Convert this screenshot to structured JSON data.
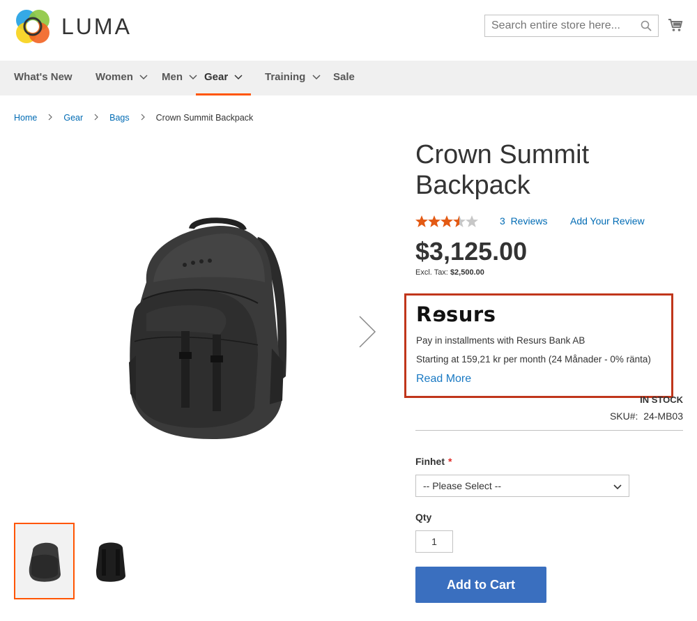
{
  "brand": {
    "name": "LUMA"
  },
  "search": {
    "placeholder": "Search entire store here..."
  },
  "nav": {
    "items": [
      {
        "label": "What's New"
      },
      {
        "label": "Women"
      },
      {
        "label": "Men"
      },
      {
        "label": "Gear"
      },
      {
        "label": "Training"
      },
      {
        "label": "Sale"
      }
    ]
  },
  "breadcrumb": {
    "items": [
      "Home",
      "Gear",
      "Bags"
    ],
    "current": "Crown Summit Backpack"
  },
  "product": {
    "title": "Crown Summit Backpack",
    "rating_stars": 3.5,
    "reviews_label": "3  Reviews",
    "add_review_label": "Add Your Review",
    "price": "$3,125.00",
    "excl_label": "Excl. Tax:",
    "excl_value": "$2,500.00",
    "stock": "IN STOCK",
    "sku_label": "SKU#:",
    "sku_value": "24-MB03"
  },
  "resurs": {
    "logo": "Rsurs",
    "line1": "Pay in installments with Resurs Bank AB",
    "line2": "Starting at 159,21 kr per month (24 Månader - 0% ränta)",
    "read_more": "Read More"
  },
  "options": {
    "finhet_label": "Finhet",
    "required_mark": "*",
    "select_value": "-- Please Select --",
    "qty_label": "Qty",
    "qty_value": "1",
    "add_to_cart": "Add to Cart"
  },
  "colors": {
    "accent": "#ff5501",
    "link": "#006bb4",
    "highlight_box": "#c0361b",
    "button": "#3a6fbf"
  }
}
